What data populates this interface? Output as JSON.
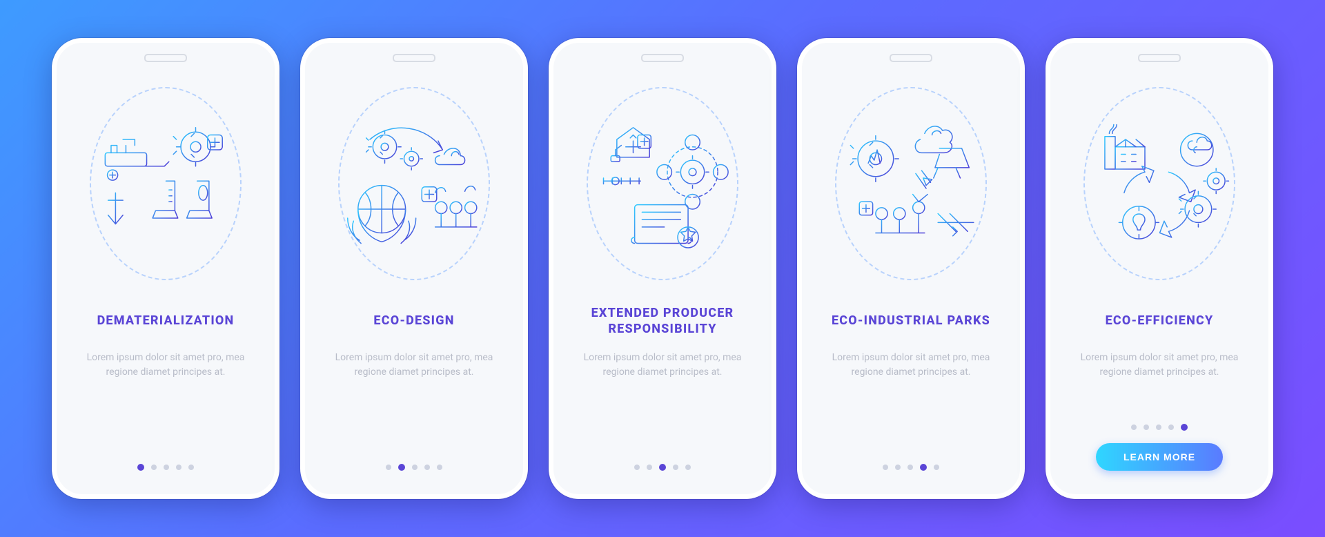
{
  "screens": [
    {
      "title": "DEMATERIALIZATION",
      "desc": "Lorem ipsum dolor sit amet pro, mea regione diamet principes at."
    },
    {
      "title": "ECO-DESIGN",
      "desc": "Lorem ipsum dolor sit amet pro, mea regione diamet principes at."
    },
    {
      "title": "EXTENDED PRODUCER RESPONSIBILITY",
      "desc": "Lorem ipsum dolor sit amet pro, mea regione diamet principes at."
    },
    {
      "title": "ECO-INDUSTRIAL PARKS",
      "desc": "Lorem ipsum dolor sit amet pro, mea regione diamet principes at."
    },
    {
      "title": "ECO-EFFICIENCY",
      "desc": "Lorem ipsum dolor sit amet pro, mea regione diamet principes at."
    }
  ],
  "cta_label": "LEARN MORE",
  "colors": {
    "grad_a": "#2fcaff",
    "grad_b": "#4d3fd8"
  }
}
